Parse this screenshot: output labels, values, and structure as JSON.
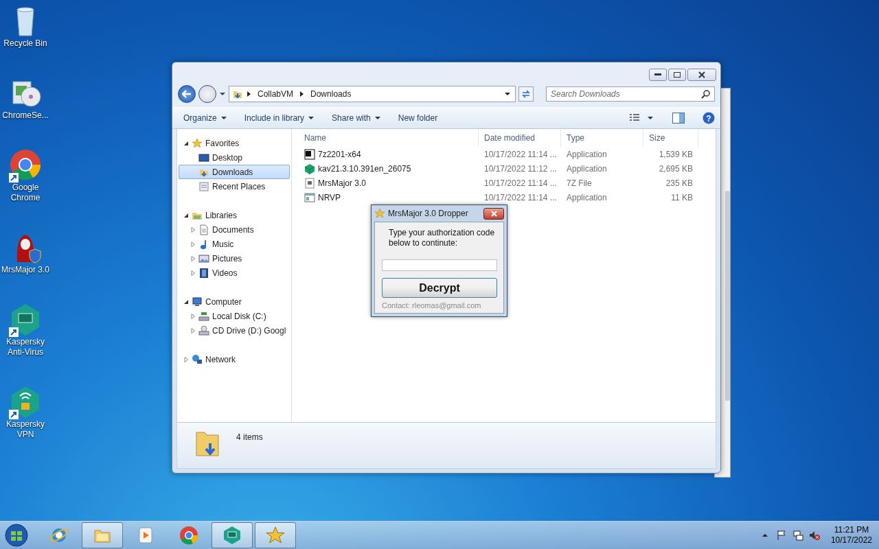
{
  "desktop_icons": [
    {
      "label": "Recycle Bin",
      "kind": "recycle",
      "shortcut": false
    },
    {
      "label": "ChromeSe...",
      "kind": "installer",
      "shortcut": false
    },
    {
      "label": "Google Chrome",
      "kind": "chrome",
      "shortcut": true
    },
    {
      "label": "MrsMajor 3.0",
      "kind": "mrsmajor",
      "shortcut": false
    },
    {
      "label": "Kaspersky Anti-Virus",
      "kind": "kaspersky",
      "shortcut": true
    },
    {
      "label": "Kaspersky VPN",
      "kind": "vpn",
      "shortcut": true
    }
  ],
  "explorer": {
    "address": [
      "CollabVM",
      "Downloads"
    ],
    "search": {
      "placeholder": "Search Downloads"
    },
    "toolbar": [
      {
        "label": "Organize",
        "dropdown": true
      },
      {
        "label": "Include in library",
        "dropdown": true
      },
      {
        "label": "Share with",
        "dropdown": true
      },
      {
        "label": "New folder",
        "dropdown": false
      }
    ],
    "tree": [
      {
        "label": "Favorites",
        "kind": "star",
        "expanded": true,
        "selected": false,
        "children": [
          {
            "label": "Desktop",
            "kind": "desktop",
            "selected": false
          },
          {
            "label": "Downloads",
            "kind": "downloads",
            "selected": true
          },
          {
            "label": "Recent Places",
            "kind": "recent",
            "selected": false
          }
        ]
      },
      {
        "label": "Libraries",
        "kind": "library",
        "expanded": true,
        "selected": false,
        "children": [
          {
            "label": "Documents",
            "kind": "documents",
            "expanded": false,
            "selected": false
          },
          {
            "label": "Music",
            "kind": "music",
            "expanded": false,
            "selected": false
          },
          {
            "label": "Pictures",
            "kind": "pictures",
            "expanded": false,
            "selected": false
          },
          {
            "label": "Videos",
            "kind": "videos",
            "expanded": false,
            "selected": false
          }
        ]
      },
      {
        "label": "Computer",
        "kind": "computer",
        "expanded": true,
        "selected": false,
        "children": [
          {
            "label": "Local Disk (C:)",
            "kind": "disk",
            "expanded": false,
            "selected": false
          },
          {
            "label": "CD Drive (D:) Googl",
            "kind": "cd",
            "expanded": false,
            "selected": false
          }
        ]
      },
      {
        "label": "Network",
        "kind": "network",
        "expanded": false,
        "selected": false
      }
    ],
    "help": "?",
    "columns": [
      "Name",
      "Date modified",
      "Type",
      "Size"
    ],
    "rows": [
      {
        "name": "7z2201-x64",
        "date": "10/17/2022 11:14 ...",
        "type": "Application",
        "size": "1,539 KB",
        "kind": "sevenzip",
        "selected": false
      },
      {
        "name": "kav21.3.10.391en_26075",
        "date": "10/17/2022 11:12 ...",
        "type": "Application",
        "size": "2,695 KB",
        "kind": "cube",
        "selected": false
      },
      {
        "name": "MrsMajor 3.0",
        "date": "10/17/2022 11:14 ...",
        "type": "7Z File",
        "size": "235 KB",
        "kind": "archive",
        "selected": false
      },
      {
        "name": "NRVP",
        "date": "10/17/2022 11:14 ...",
        "type": "Application",
        "size": "11 KB",
        "kind": "app",
        "selected": false
      }
    ],
    "status": "4 items"
  },
  "dialog": {
    "title": "MrsMajor 3.0 Dropper",
    "message": "Type your authorization code below to continute:",
    "button": "Decrypt",
    "contact": "Contact: rleomas@gmail.com"
  },
  "taskbar": {
    "items": [
      {
        "kind": "ie",
        "open": false
      },
      {
        "kind": "explorer",
        "open": true
      },
      {
        "kind": "media",
        "open": false
      },
      {
        "kind": "chrome",
        "open": false
      },
      {
        "kind": "kaspersky",
        "open": true
      },
      {
        "kind": "star",
        "open": true
      }
    ],
    "time": "11:21 PM",
    "date": "10/17/2022"
  }
}
